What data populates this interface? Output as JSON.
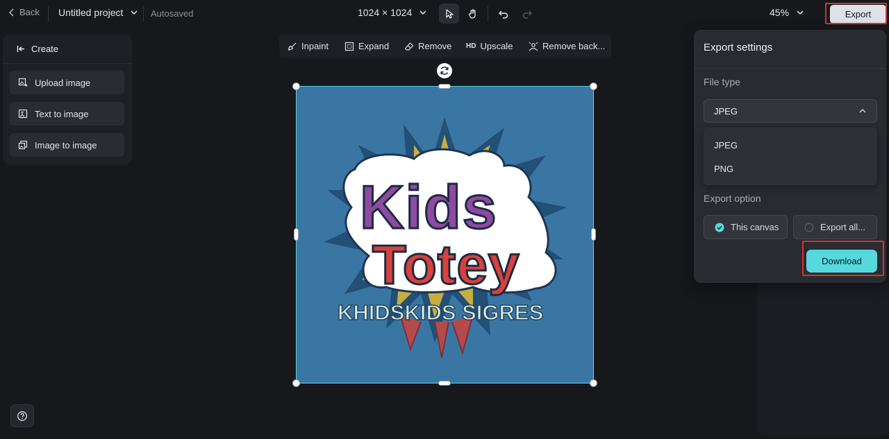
{
  "topbar": {
    "back_label": "Back",
    "project_name": "Untitled project",
    "save_status": "Autosaved",
    "canvas_size": "1024 × 1024",
    "zoom": "45%",
    "export_label": "Export"
  },
  "left_panel": {
    "header": "Create",
    "items": [
      {
        "label": "Upload image",
        "icon": "upload-image-icon"
      },
      {
        "label": "Text to image",
        "icon": "text-to-image-icon"
      },
      {
        "label": "Image to image",
        "icon": "image-to-image-icon"
      }
    ]
  },
  "edit_toolbar": {
    "inpaint": "Inpaint",
    "expand": "Expand",
    "remove": "Remove",
    "upscale_badge": "HD",
    "upscale": "Upscale",
    "remove_background": "Remove back..."
  },
  "canvas": {
    "image_text_main_1": "Kids",
    "image_text_main_2": "Totey",
    "image_text_sub": "KHIDSKIDS SIGRES",
    "background_color": "#3a76a4",
    "selection_color": "#5fd0e0"
  },
  "export_panel": {
    "title": "Export settings",
    "file_type_label": "File type",
    "selected_file_type": "JPEG",
    "file_type_options": [
      "JPEG",
      "PNG"
    ],
    "export_option_label": "Export option",
    "options": [
      {
        "label": "This canvas",
        "selected": true
      },
      {
        "label": "Export all...",
        "selected": false
      }
    ],
    "download_label": "Download",
    "accent_color": "#56d8dd"
  },
  "highlight_color": "#d2352b"
}
